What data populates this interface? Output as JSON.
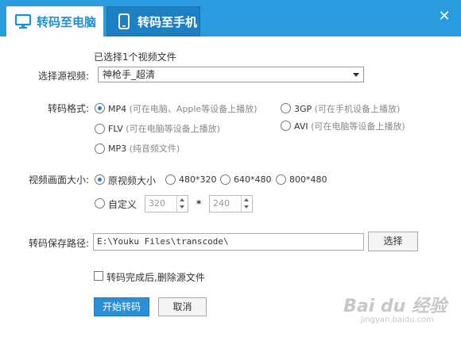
{
  "tabs": {
    "pc_label": "转码至电脑",
    "phone_label": "转码至手机"
  },
  "close_symbol": "✕",
  "source": {
    "selected_info": "已选择1个视频文件",
    "label": "选择源视频:",
    "value": "神枪手_超清"
  },
  "format": {
    "label": "转码格式:",
    "options": [
      {
        "name": "MP4",
        "hint": "(可在电脑、Apple等设备上播放)",
        "selected": true
      },
      {
        "name": "3GP",
        "hint": "(可在手机设备上播放)",
        "selected": false
      },
      {
        "name": "FLV",
        "hint": "(可在电脑等设备上播放)",
        "selected": false
      },
      {
        "name": "AVI",
        "hint": "(可在电脑等设备上播放)",
        "selected": false
      },
      {
        "name": "MP3",
        "hint": "(纯音频文件)",
        "selected": false
      }
    ]
  },
  "size": {
    "label": "视频画面大小:",
    "options": [
      {
        "name": "原视频大小",
        "selected": true
      },
      {
        "name": "480*320",
        "selected": false
      },
      {
        "name": "640*480",
        "selected": false
      },
      {
        "name": "800*480",
        "selected": false
      }
    ],
    "custom_label": "自定义",
    "width": "320",
    "separator": "*",
    "height": "240"
  },
  "path": {
    "label": "转码保存路径:",
    "value": "E:\\Youku Files\\transcode\\",
    "browse_label": "选择"
  },
  "delete_source": {
    "label": "转码完成后,删除源文件",
    "checked": false
  },
  "actions": {
    "start_label": "开始转码",
    "cancel_label": "取消"
  },
  "watermark": {
    "brand": "Bai du 经验",
    "url": "jingyan.baidu.com"
  },
  "colors": {
    "titlebar": "#2b9be0",
    "accent": "#2b8fd8"
  }
}
